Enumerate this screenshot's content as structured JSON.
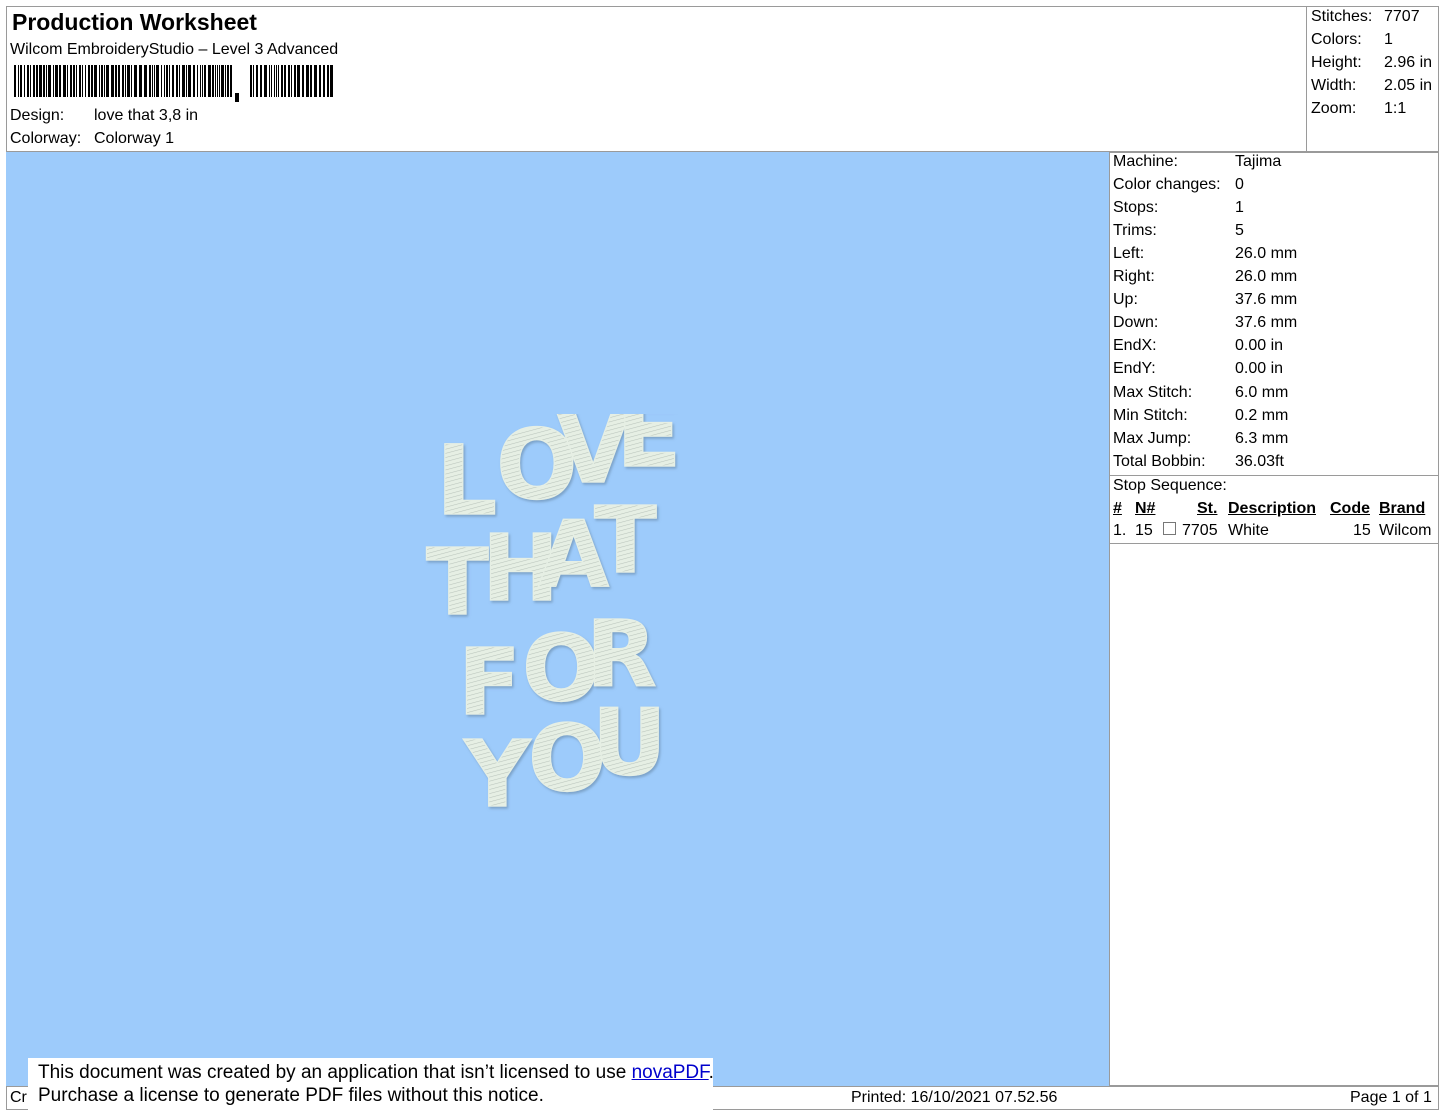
{
  "header": {
    "title": "Production Worksheet",
    "subtitle": "Wilcom EmbroideryStudio – Level 3 Advanced",
    "design_label": "Design:",
    "design_value": "love that 3,8 in",
    "colorway_label": "Colorway:",
    "colorway_value": "Colorway 1",
    "stats": {
      "stitches_label": "Stitches:",
      "stitches_value": "7707",
      "colors_label": "Colors:",
      "colors_value": "1",
      "height_label": "Height:",
      "height_value": "2.96 in",
      "width_label": "Width:",
      "width_value": "2.05 in",
      "zoom_label": "Zoom:",
      "zoom_value": "1:1"
    }
  },
  "design": {
    "background_color": "#9dcbfb",
    "thread_color": "#e6efe4",
    "lines": [
      "LOVE",
      "THAT",
      "FOR",
      "YOU"
    ]
  },
  "machine_info": {
    "machine_label": "Machine:",
    "machine_value": "Tajima",
    "color_changes_label": "Color changes:",
    "color_changes_value": "0",
    "stops_label": "Stops:",
    "stops_value": "1",
    "trims_label": "Trims:",
    "trims_value": "5",
    "left_label": "Left:",
    "left_value": "26.0 mm",
    "right_label": "Right:",
    "right_value": "26.0 mm",
    "up_label": "Up:",
    "up_value": "37.6 mm",
    "down_label": "Down:",
    "down_value": "37.6 mm",
    "endx_label": "EndX:",
    "endx_value": "0.00 in",
    "endy_label": "EndY:",
    "endy_value": "0.00 in",
    "max_stitch_label": "Max Stitch:",
    "max_stitch_value": "6.0 mm",
    "min_stitch_label": "Min Stitch:",
    "min_stitch_value": "0.2 mm",
    "max_jump_label": "Max Jump:",
    "max_jump_value": "6.3 mm",
    "total_bobbin_label": "Total Bobbin:",
    "total_bobbin_value": "36.03ft"
  },
  "stop_sequence": {
    "title": "Stop Sequence:",
    "headers": {
      "num": "#",
      "n": "N#",
      "st": "St.",
      "description": "Description",
      "code": "Code",
      "brand": "Brand"
    },
    "rows": [
      {
        "num": "1.",
        "n": "15",
        "st": "7705",
        "description": "White",
        "code": "15",
        "brand": "Wilcom",
        "swatch_color": "#ffffff"
      }
    ]
  },
  "footer": {
    "left_text": "Cr",
    "printed": "Printed: 16/10/2021 07.52.56",
    "page": "Page 1 of 1"
  },
  "notice": {
    "line1_prefix": "This document was created by an application that isn’t licensed to use ",
    "link_text": "novaPDF",
    "line1_suffix": ".",
    "line2": "Purchase a license to generate PDF files without this notice."
  }
}
